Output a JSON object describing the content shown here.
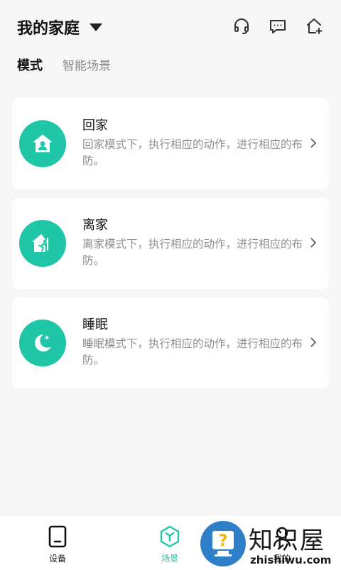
{
  "header": {
    "home_title": "我的家庭",
    "icons": [
      "headset-icon",
      "message-icon",
      "add-home-icon"
    ]
  },
  "tabs": [
    {
      "label": "模式",
      "active": true
    },
    {
      "label": "智能场景",
      "active": false
    }
  ],
  "modes": [
    {
      "title": "回家",
      "description": "回家模式下，执行相应的动作，进行相应的布防。",
      "icon": "home-icon"
    },
    {
      "title": "离家",
      "description": "离家模式下，执行相应的动作，进行相应的布防。",
      "icon": "leave-home-icon"
    },
    {
      "title": "睡眠",
      "description": "睡眠模式下，执行相应的动作，进行相应的布防。",
      "icon": "moon-icon"
    }
  ],
  "tabbar": {
    "devices": "设备",
    "scenes": "场景",
    "mine": "我的"
  },
  "watermark": {
    "brand": "知识屋",
    "domain": "zhishiwu.com"
  },
  "colors": {
    "accent": "#1fc6a8",
    "background": "#f6f6f6"
  }
}
